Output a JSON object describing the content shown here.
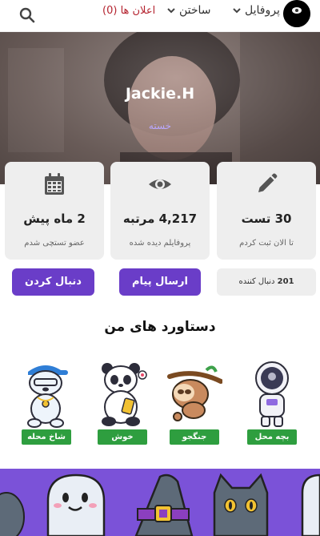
{
  "navbar": {
    "ads_label": "اعلان ها (0)",
    "build_label": "ساختن",
    "profile_label": "پروفایل"
  },
  "profile": {
    "name": "Jackie.H",
    "status": "خسته"
  },
  "stats": [
    {
      "icon": "pencil-icon",
      "value": "30 تست",
      "caption": "تا الان ثبت کردم"
    },
    {
      "icon": "eye-icon",
      "value": "4,217 مرتبه",
      "caption": "پروفایلم دیده شده"
    },
    {
      "icon": "calendar-icon",
      "value": "2 ماه پیش",
      "caption": "عضو تستچی شدم"
    }
  ],
  "actions": {
    "followers_count": "201",
    "followers_label": "دنبال کننده",
    "message_label": "ارسال پیام",
    "follow_label": "دنبال کردن"
  },
  "achievements": {
    "title": "دستاورد های من",
    "badges": [
      {
        "icon": "astronaut-icon",
        "label": "بچه محل"
      },
      {
        "icon": "sloth-icon",
        "label": "جنگجو"
      },
      {
        "icon": "panda-icon",
        "label": "خوش شانس"
      },
      {
        "icon": "polar-bear-icon",
        "label": "شاخ محله"
      }
    ]
  },
  "colors": {
    "accent": "#6a3dc8",
    "badge_green": "#2e9e3f",
    "ads_red": "#b4232f",
    "banner_purple": "#7b52d8"
  }
}
